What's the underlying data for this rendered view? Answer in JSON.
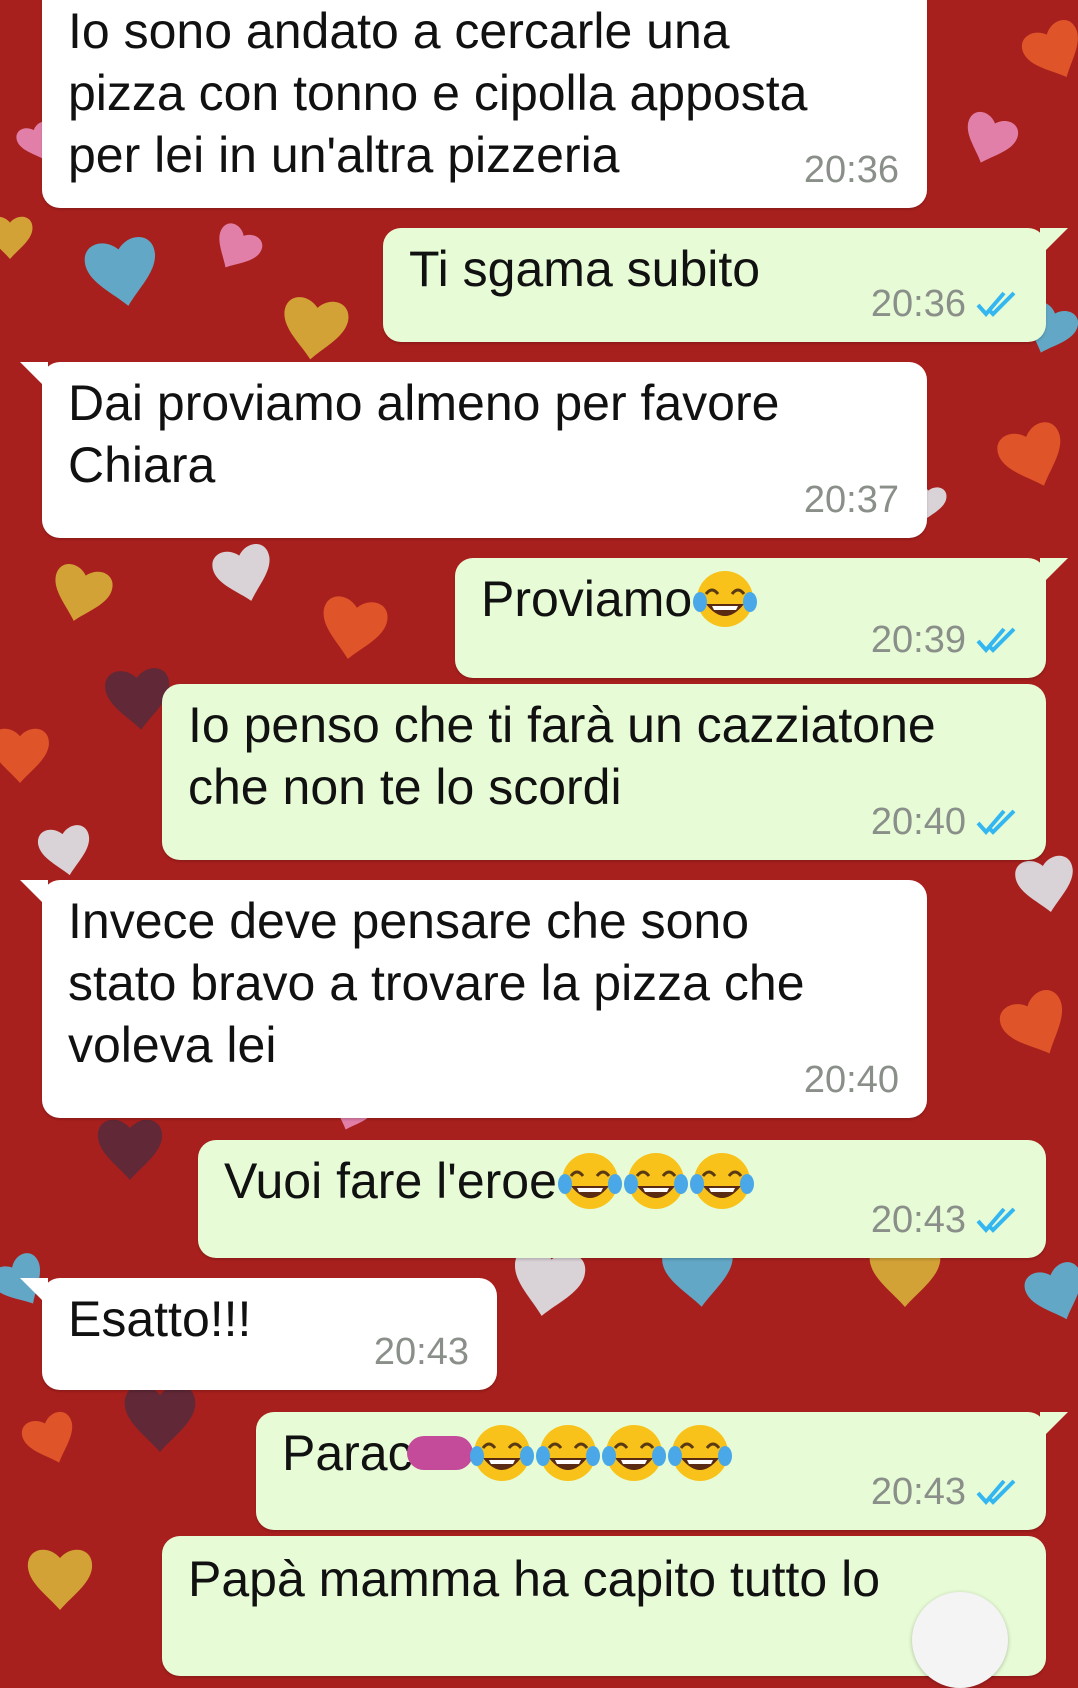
{
  "chat": {
    "messages": [
      {
        "id": "m1",
        "direction": "incoming",
        "text": "Io sono andato a cercarle una\npizza con tonno e cipolla apposta\nper lei in un'altra pizzeria",
        "time": "20:36"
      },
      {
        "id": "m2",
        "direction": "outgoing",
        "text": "Ti sgama subito",
        "time": "20:36",
        "status": "read"
      },
      {
        "id": "m3",
        "direction": "incoming",
        "text": "Dai proviamo almeno per favore\nChiara",
        "time": "20:37"
      },
      {
        "id": "m4",
        "direction": "outgoing",
        "text": "Proviamo",
        "emoji_count": 1,
        "emoji": "face-with-tears-of-joy",
        "time": "20:39",
        "status": "read"
      },
      {
        "id": "m5",
        "direction": "outgoing",
        "text": "Io penso che ti farà un cazziatone\nche non te lo scordi",
        "time": "20:40",
        "status": "read"
      },
      {
        "id": "m6",
        "direction": "incoming",
        "text": "Invece deve pensare che sono\nstato bravo a trovare la pizza che\nvoleva lei",
        "time": "20:40"
      },
      {
        "id": "m7",
        "direction": "outgoing",
        "text": "Vuoi fare l'eroe",
        "emoji_count": 3,
        "emoji": "face-with-tears-of-joy",
        "time": "20:43",
        "status": "read"
      },
      {
        "id": "m8",
        "direction": "incoming",
        "text": "Esatto!!!",
        "time": "20:43"
      },
      {
        "id": "m9",
        "direction": "outgoing",
        "text": "Parac",
        "redacted": true,
        "emoji_count": 4,
        "emoji": "face-with-tears-of-joy",
        "time": "20:43",
        "status": "read"
      },
      {
        "id": "m10",
        "direction": "outgoing",
        "text": "Papà mamma ha capito tutto lo",
        "time": "",
        "status": ""
      }
    ]
  },
  "colors": {
    "wallpaper": "#a8201d",
    "incoming_bubble": "#ffffff",
    "outgoing_bubble": "#e7fcd6",
    "read_tick": "#34b7f1",
    "timestamp": "#8a8f8a",
    "redaction": "#c44b9a"
  },
  "icons": {
    "read_receipt": "double-check-icon",
    "emoji": "face-with-tears-of-joy",
    "scroll_button": "scroll-down-button"
  }
}
